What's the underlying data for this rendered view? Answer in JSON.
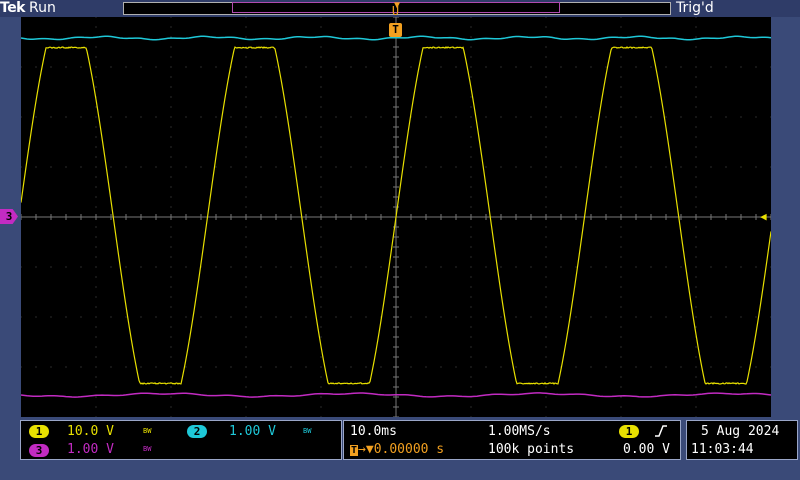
{
  "header": {
    "brand": "Tek",
    "acq_state": "Run",
    "trigger_status": "Trig'd"
  },
  "markers": {
    "trigger_position": "T",
    "trigger_top": "U",
    "ch3_marker": "3"
  },
  "waveforms": {
    "ch1_color": "#e8e000",
    "ch2_color": "#1ec8d8",
    "ch3_color": "#c22bc2"
  },
  "channels": {
    "ch1": {
      "number": "1",
      "scale": "10.0 V",
      "bw": "BW"
    },
    "ch2": {
      "number": "2",
      "scale": "1.00 V",
      "bw": "BW"
    },
    "ch3": {
      "number": "3",
      "scale": "1.00 V",
      "bw": "BW"
    }
  },
  "horizontal": {
    "time_div": "10.0ms",
    "sample_rate": "1.00MS/s",
    "trigger_offset": "0.00000 s",
    "record_length": "100k points"
  },
  "trigger": {
    "source": "1",
    "slope": "rising",
    "level": "0.00 V"
  },
  "datetime": {
    "date": "5 Aug 2024",
    "time": "11:03:44"
  }
}
